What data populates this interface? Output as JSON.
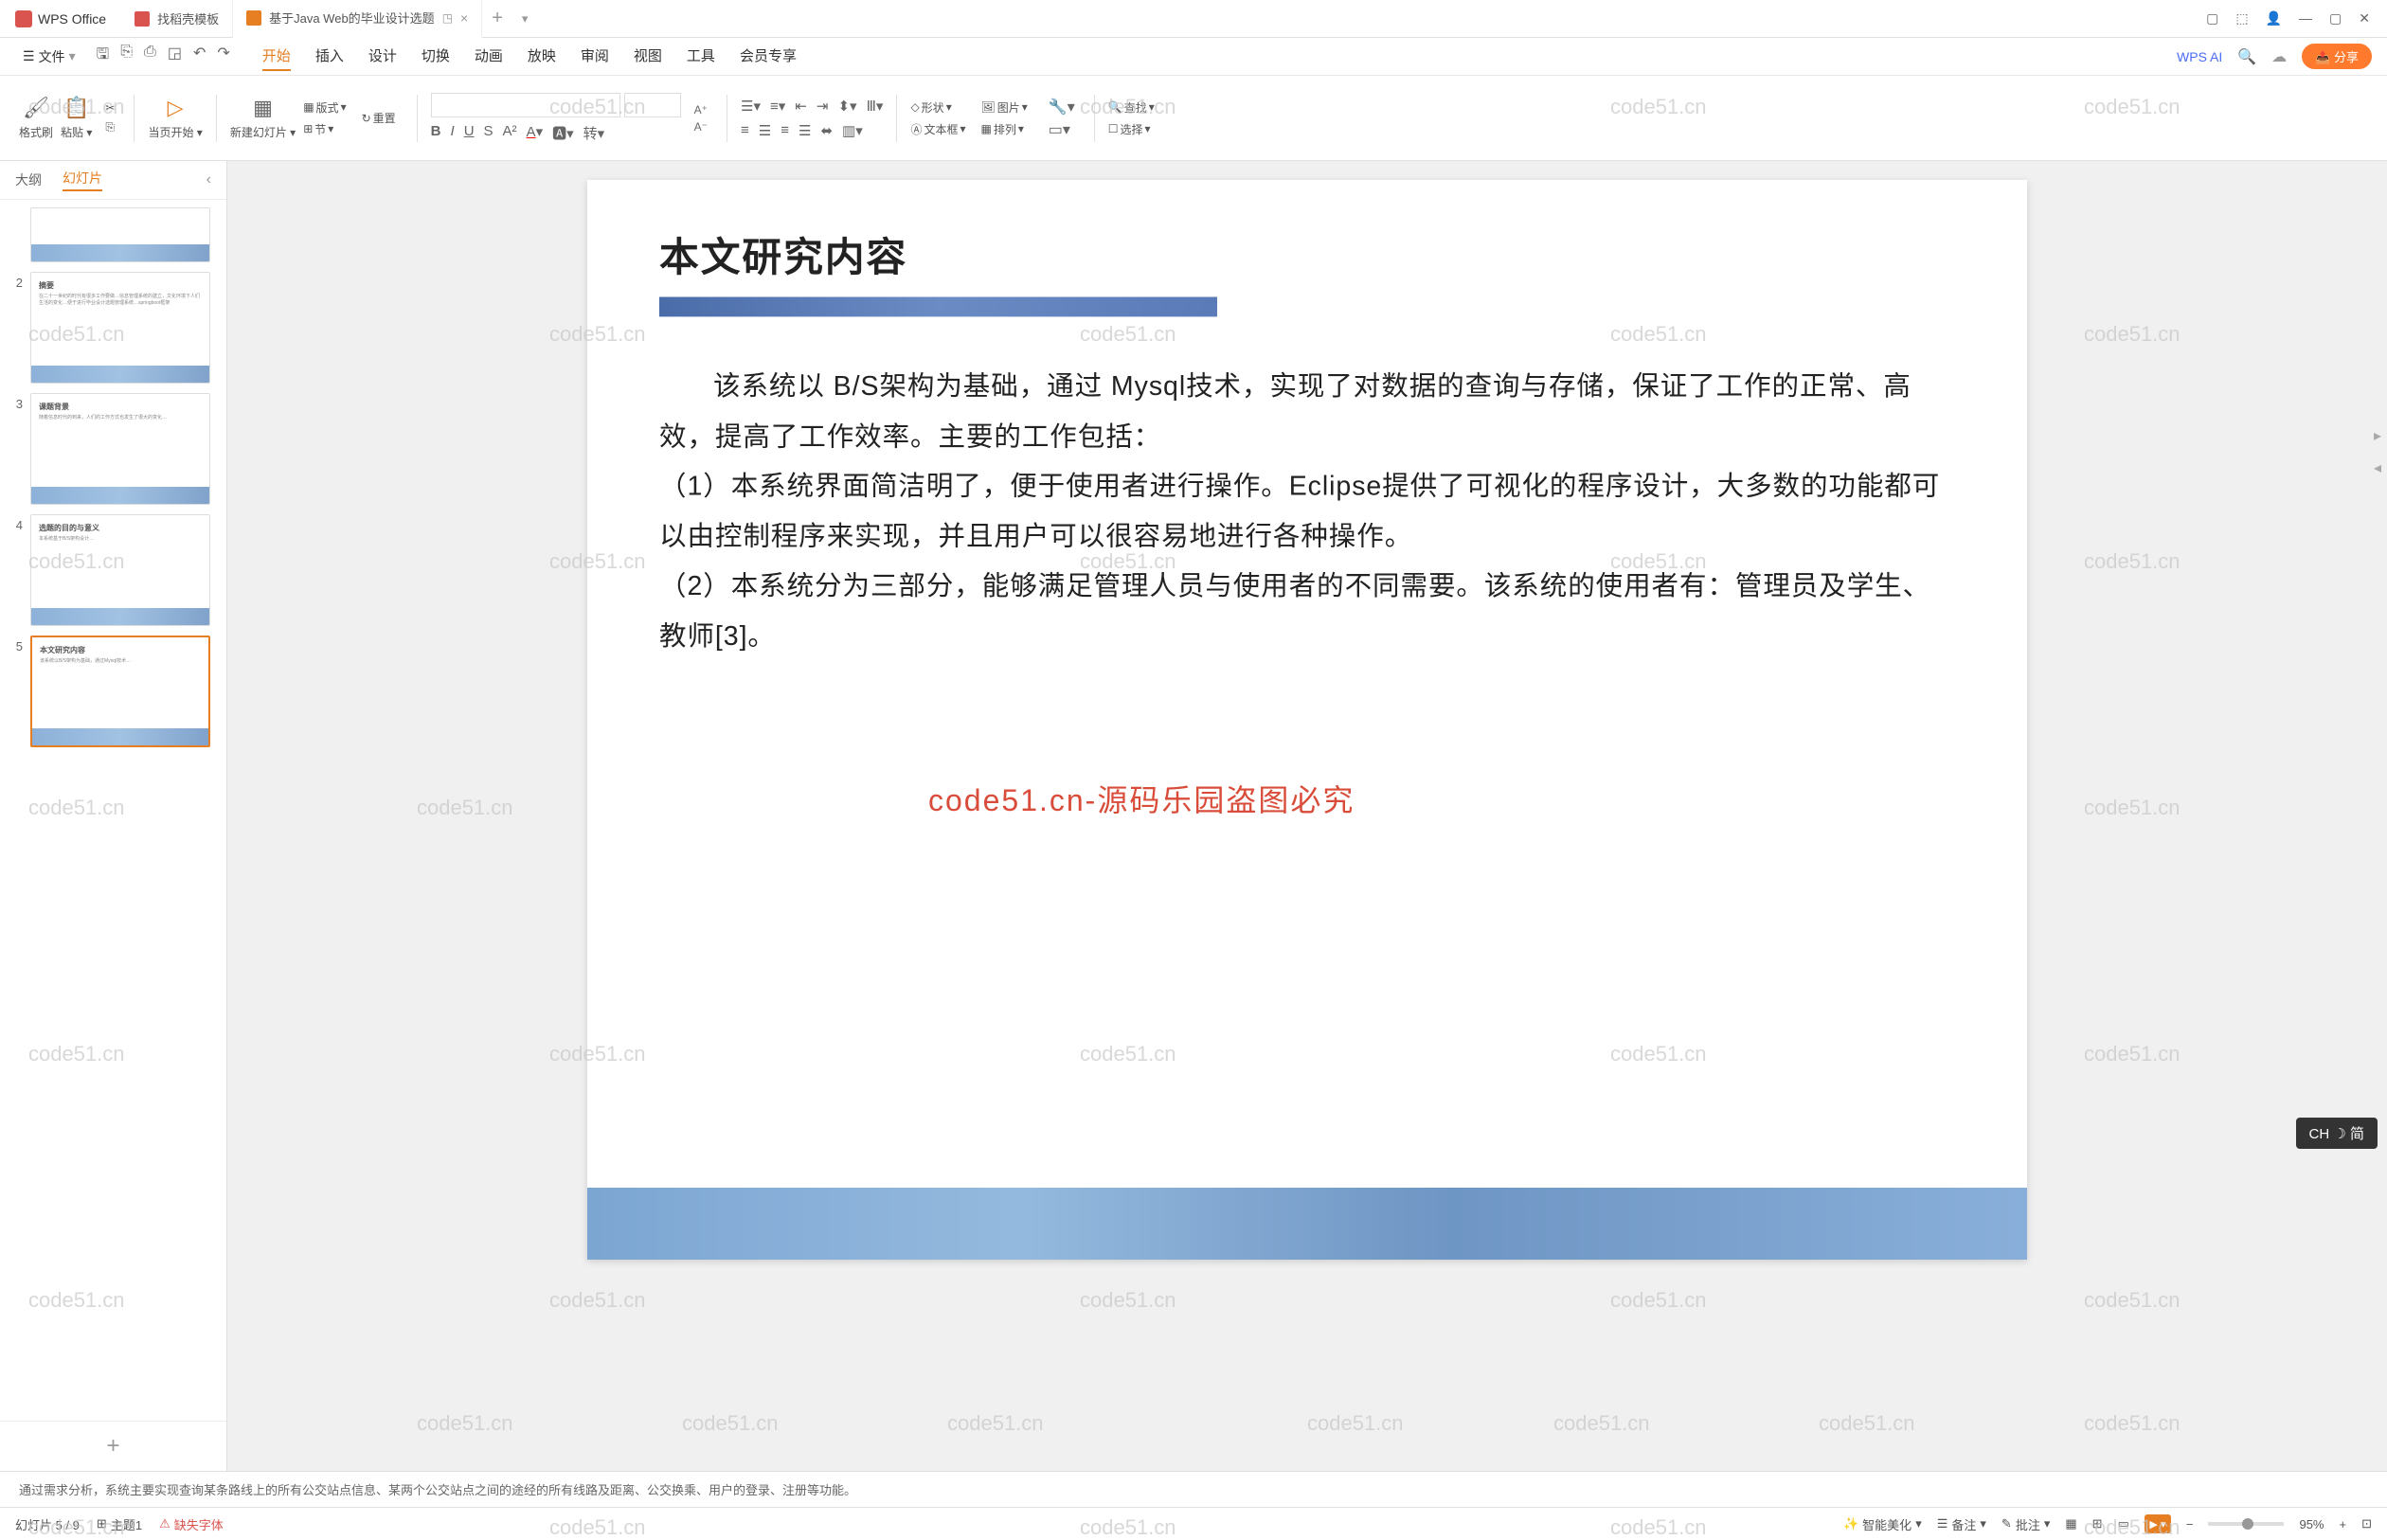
{
  "titlebar": {
    "app_name": "WPS Office",
    "tab1": "找稻壳模板",
    "tab2": "基于Java Web的毕业设计选题",
    "tab_present_icon": "◳"
  },
  "menubar": {
    "file": "文件",
    "tabs": [
      "开始",
      "插入",
      "设计",
      "切换",
      "动画",
      "放映",
      "审阅",
      "视图",
      "工具",
      "会员专享"
    ],
    "wps_ai": "WPS AI",
    "share": "分享"
  },
  "ribbon": {
    "format_brush": "格式刷",
    "paste": "粘贴",
    "from_current": "当页开始",
    "new_slide": "新建幻灯片",
    "layout": "版式",
    "section": "节",
    "reset": "重置",
    "text_box": "文本框",
    "shape": "形状",
    "picture": "图片",
    "arrange": "排列",
    "find": "查找",
    "select": "选择",
    "convert": "转"
  },
  "sidepanel": {
    "tab_outline": "大纲",
    "tab_slides": "幻灯片",
    "thumbs": [
      {
        "num": "",
        "title": ""
      },
      {
        "num": "2",
        "title": "摘要"
      },
      {
        "num": "3",
        "title": "课题背景"
      },
      {
        "num": "4",
        "title": "选题的目的与意义"
      },
      {
        "num": "5",
        "title": "本文研究内容"
      }
    ]
  },
  "slide": {
    "title": "本文研究内容",
    "body_p1": "该系统以 B/S架构为基础，通过 Mysql技术，实现了对数据的查询与存储，保证了工作的正常、高效，提高了工作效率。主要的工作包括：",
    "body_p2": "（1）本系统界面简洁明了，便于使用者进行操作。Eclipse提供了可视化的程序设计，大多数的功能都可以由控制程序来实现，并且用户可以很容易地进行各种操作。",
    "body_p3": "（2）本系统分为三部分，能够满足管理人员与使用者的不同需要。该系统的使用者有：管理员及学生、教师[3]。"
  },
  "watermark": {
    "text": "code51.cn",
    "red_text": "code51.cn-源码乐园盗图必究"
  },
  "notes": {
    "text": "通过需求分析，系统主要实现查询某条路线上的所有公交站点信息、某两个公交站点之间的途经的所有线路及距离、公交换乘、用户的登录、注册等功能。"
  },
  "statusbar": {
    "slide_count": "幻灯片 5 / 9",
    "theme": "主题1",
    "missing_font": "缺失字体",
    "smart_beautify": "智能美化",
    "notes": "备注",
    "comments": "批注",
    "zoom": "95%"
  },
  "ime": {
    "text": "CH ☽ 简"
  }
}
